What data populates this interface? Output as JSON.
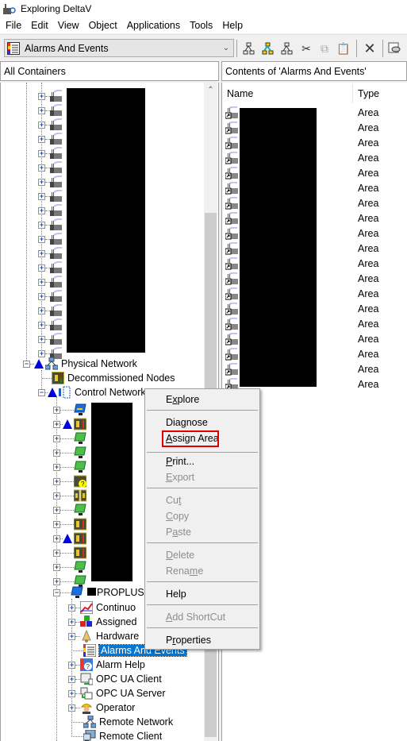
{
  "window": {
    "title": "Exploring DeltaV",
    "app_icon": "deltav-explorer-icon"
  },
  "menubar": [
    "File",
    "Edit",
    "View",
    "Object",
    "Applications",
    "Tools",
    "Help"
  ],
  "toolbar": {
    "combo_value": "Alarms And Events",
    "combo_icon": "alarms-and-events-icon",
    "buttons": [
      "area-network-icon",
      "assign-network-icon",
      "link-network-icon",
      "cut-icon",
      "copy-icon",
      "paste-icon",
      "delete-icon",
      "properties-icon"
    ]
  },
  "left_pane": {
    "header": "All Containers"
  },
  "right_pane": {
    "header": "Contents of 'Alarms And Events'",
    "columns": [
      "Name",
      "Type"
    ],
    "rows": [
      "Area",
      "Area",
      "Area",
      "Area",
      "Area",
      "Area",
      "Area",
      "Area",
      "Area",
      "Area",
      "Area",
      "Area",
      "Area",
      "Area",
      "Area",
      "Area",
      "Area",
      "Area",
      "Area"
    ]
  },
  "tree": {
    "area_rows": 19,
    "physical_network": "Physical Network",
    "decommissioned_nodes": "Decommissioned Nodes",
    "control_network": "Control Network",
    "node_icons": [
      "workstation-blue",
      "controller-warn",
      "workstation-green",
      "workstation-green",
      "workstation-green",
      "controller-unknown",
      "controller-dual",
      "workstation-green",
      "controller",
      "controller-warn",
      "controller",
      "workstation-green",
      "workstation-green"
    ],
    "proplus": "PROPLUS",
    "proplus_children": [
      {
        "label": "Continuo",
        "icon": "continuous-historian-icon",
        "expandable": true
      },
      {
        "label": "Assigned",
        "icon": "assigned-modules-icon",
        "expandable": true
      },
      {
        "label": "Hardware",
        "icon": "hardware-alarms-icon",
        "expandable": true
      },
      {
        "label": "Alarms And Events",
        "icon": "alarms-and-events-icon",
        "expandable": false,
        "selected": true
      },
      {
        "label": "Alarm Help",
        "icon": "alarm-help-icon",
        "expandable": true
      },
      {
        "label": "OPC UA Client",
        "icon": "opc-ua-client-icon",
        "expandable": true
      },
      {
        "label": "OPC UA Server",
        "icon": "opc-ua-server-icon",
        "expandable": true
      },
      {
        "label": "Operator",
        "icon": "operator-icon",
        "expandable": true
      },
      {
        "label": "Remote Network",
        "icon": "remote-network-icon",
        "expandable": false
      },
      {
        "label": "Remote Client",
        "icon": "remote-client-icon",
        "expandable": false
      }
    ]
  },
  "context_menu": {
    "items": [
      {
        "label": "Explore",
        "enabled": true
      },
      {
        "label": "Diagnose",
        "enabled": true
      },
      {
        "label": "Assign Area",
        "enabled": true,
        "highlighted": true
      },
      {
        "label": "Print...",
        "enabled": true
      },
      {
        "label": "Export",
        "enabled": false
      },
      {
        "label": "Cut",
        "enabled": false
      },
      {
        "label": "Copy",
        "enabled": false
      },
      {
        "label": "Paste",
        "enabled": false
      },
      {
        "label": "Delete",
        "enabled": false
      },
      {
        "label": "Rename",
        "enabled": false
      },
      {
        "label": "Help",
        "enabled": true
      },
      {
        "label": "Add ShortCut",
        "enabled": false
      },
      {
        "label": "Properties",
        "enabled": true
      }
    ]
  },
  "colors": {
    "selection": "#0078d7",
    "highlight_box": "#e00000",
    "warning_triangle": "#0000e0"
  }
}
